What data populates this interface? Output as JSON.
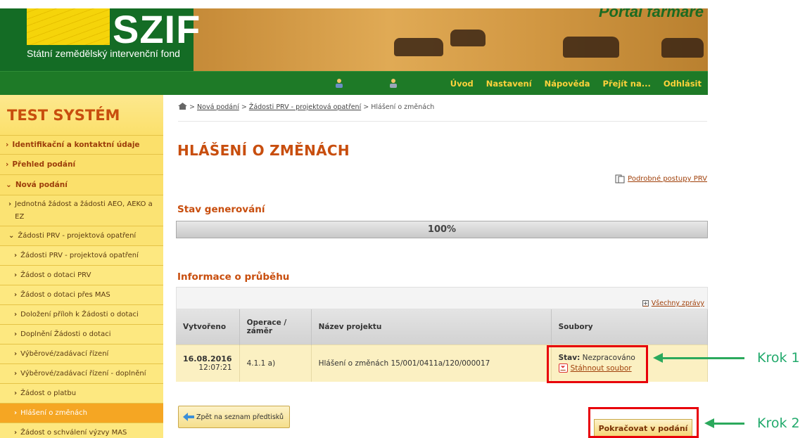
{
  "header": {
    "logo_text": "SZIF",
    "logo_subtitle": "Státní zemědělský intervenční fond",
    "portal_title": "Portál farmáře"
  },
  "nav": {
    "items": [
      "Úvod",
      "Nastavení",
      "Nápověda",
      "Přejít na...",
      "Odhlásit"
    ]
  },
  "sidebar": {
    "title": "TEST SYSTÉM",
    "items": [
      {
        "label": "Identifikační a kontaktní údaje",
        "chev": "›"
      },
      {
        "label": "Přehled podání",
        "chev": "›"
      },
      {
        "label": "Nová podání",
        "chev": "⌄"
      },
      {
        "label": "Jednotná žádost a žádosti AEO, AEKO a EZ",
        "chev": "›"
      },
      {
        "label": "Žádosti PRV - projektová opatření",
        "chev": "⌄"
      },
      {
        "label": "Žádosti PRV - projektová opatření",
        "chev": "›"
      },
      {
        "label": "Žádost o dotaci PRV",
        "chev": "›"
      },
      {
        "label": "Žádost o dotaci přes MAS",
        "chev": "›"
      },
      {
        "label": "Doložení příloh k Žádosti o dotaci",
        "chev": "›"
      },
      {
        "label": "Doplnění Žádosti o dotaci",
        "chev": "›"
      },
      {
        "label": "Výběrové/zadávací řízení",
        "chev": "›"
      },
      {
        "label": "Výběrové/zadávací řízení - doplnění",
        "chev": "›"
      },
      {
        "label": "Žádost o platbu",
        "chev": "›"
      },
      {
        "label": "Hlášení o změnách",
        "chev": "›"
      },
      {
        "label": "Žádost o schválení výzvy MAS",
        "chev": "›"
      }
    ]
  },
  "breadcrumb": {
    "items": [
      "Nová podání",
      "Žádosti PRV - projektová opatření"
    ],
    "current": "Hlášení o změnách",
    "sep": ">"
  },
  "main": {
    "title": "HLÁŠENÍ O ZMĚNÁCH",
    "postupy_link": "Podrobné postupy PRV",
    "stav_heading": "Stav generování",
    "progress_text": "100%",
    "progress_value": 100,
    "info_heading": "Informace o průběhu",
    "all_messages": "Všechny zprávy",
    "table": {
      "headers": [
        "Vytvořeno",
        "Operace / záměr",
        "Název projektu",
        "Soubory"
      ],
      "rows": [
        {
          "date": "16.08.2016",
          "time": "12:07:21",
          "operation": "4.1.1 a)",
          "name": "Hlášení o změnách 15/001/0411a/120/000017",
          "status_label": "Stav:",
          "status_value": "Nezpracováno",
          "download": "Stáhnout soubor"
        }
      ]
    },
    "back_button": "Zpět na seznam předtisků",
    "continue_button": "Pokračovat v podání"
  },
  "annotations": {
    "step1": "Krok 1",
    "step2": "Krok 2",
    "highlight_color": "#e8000a",
    "arrow_color": "#2ba95c"
  }
}
